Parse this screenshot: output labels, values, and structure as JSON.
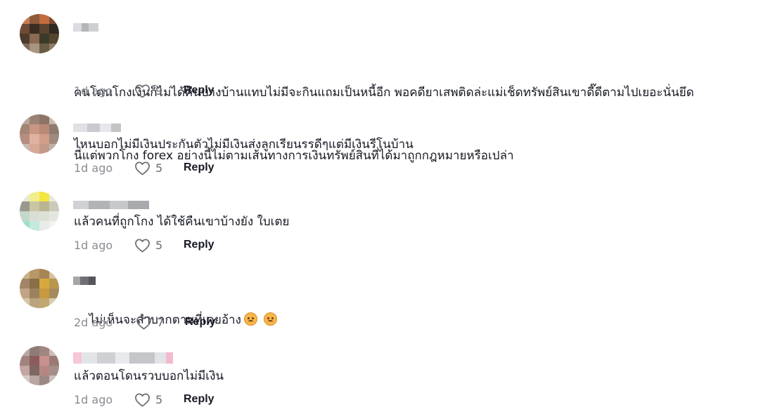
{
  "comments": [
    {
      "text": "คนโดนโกงเงินก็ไม่ได้คืนบางบ้านแทบไม่มีจะกินแถมเป็นหนี้อีก พอคดียาเสพติดล่ะแม่เช็ดทรัพย์สินเขาดี๊ดีตามไปเยอะนั่นยึดนี่แต่พวกโกง forex อย่างนี้ไม่ตามเส้นทางการเงินทรัพย์สินที่ได้มาถูกกฎหมายหรือเปล่า",
      "line1": "คนโดนโกงเงินก็ไม่ได้คืนบางบ้านแทบไม่มีจะกินแถมเป็นหนี้อีก พอคดียาเสพติดล่ะแม่เช็ดทรัพย์สินเขาดี๊ดีตามไปเยอะนั่นยึด",
      "line2": "นี่แต่พวกโกง forex อย่างนี้ไม่ตามเส้นทางการเงินทรัพย์สินที่ได้มาถูกกฎหมายหรือเปล่า",
      "time": "1d ago",
      "likes": "9",
      "reply": "Reply"
    },
    {
      "text": "ไหนบอกไม่มีเงินประกันตัวไม่มีเงินส่งลูกเรียนรรดีๆแต่มีเงินรีโนบ้าน",
      "time": "1d ago",
      "likes": "5",
      "reply": "Reply"
    },
    {
      "text": "แล้วคนที่ถูกโกง ได้ใช้คืนเขาบ้างยัง ใบเตย",
      "time": "1d ago",
      "likes": "5",
      "reply": "Reply"
    },
    {
      "text": "ไม่เห็นจะลำบากตามที่เคยอ้าง",
      "emoji": [
        "disappointed-face-emoji",
        "disappointed-face-emoji"
      ],
      "time": "2d ago",
      "likes": "7",
      "reply": "Reply"
    },
    {
      "text": "แล้วตอนโดนรวบบอกไม่มีเงิน",
      "time": "1d ago",
      "likes": "5",
      "reply": "Reply"
    }
  ],
  "icons": {
    "like": "heart-outline-icon"
  },
  "colors": {
    "text": "#161823",
    "meta": "#8a8b91",
    "background": "#ffffff"
  }
}
